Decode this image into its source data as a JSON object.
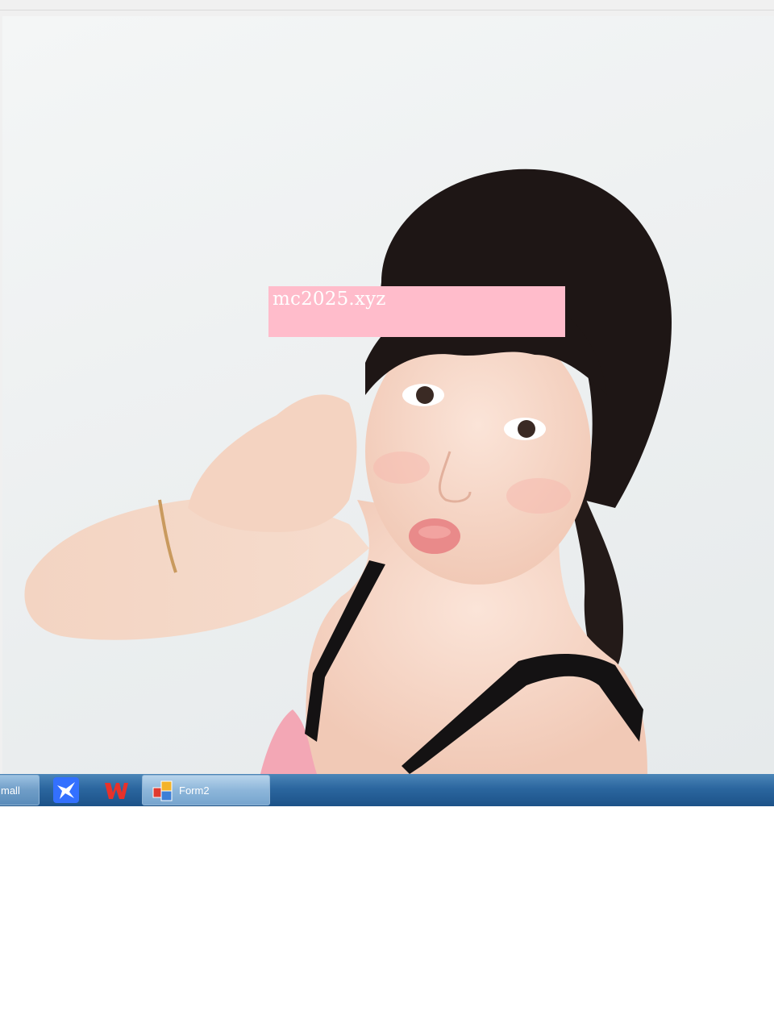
{
  "overlay": {
    "url_text": "mc2025.xyz"
  },
  "taskbar": {
    "buttons": [
      {
        "label": "mall",
        "icon": "app-window-icon"
      },
      {
        "label": "",
        "icon": "feishu-bird-icon"
      },
      {
        "label": "",
        "icon": "wps-office-icon"
      },
      {
        "label": "Form2",
        "icon": "form2-app-icon"
      }
    ]
  },
  "colors": {
    "overlay_bg": "#ffbccb",
    "taskbar": "#2b669f",
    "wps_red": "#e8312a",
    "feishu_blue": "#3370ff"
  }
}
